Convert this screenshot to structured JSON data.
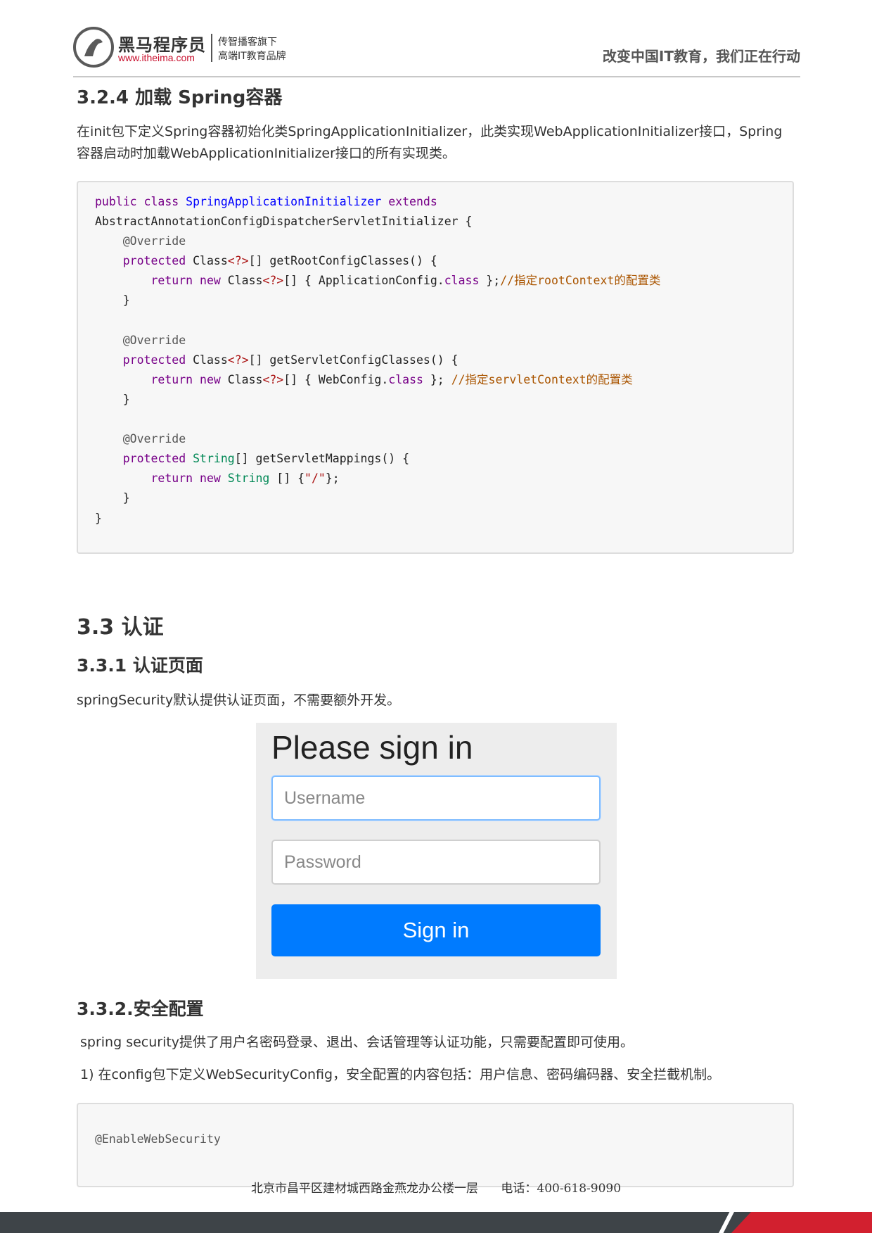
{
  "header": {
    "brand_name": "黑马程序员",
    "brand_url": "www.itheima.com",
    "brand_tag1": "传智播客旗下",
    "brand_tag2": "高端IT教育品牌",
    "slogan": "改变中国IT教育，我们正在行动"
  },
  "section_324": {
    "heading": "3.2.4 加载 Spring容器",
    "desc": "在init包下定义Spring容器初始化类SpringApplicationInitializer，此类实现WebApplicationInitializer接口，Spring容器启动时加载WebApplicationInitializer接口的所有实现类。"
  },
  "section_33": {
    "heading": "3.3 认证"
  },
  "section_331": {
    "heading": "3.3.1 认证页面",
    "desc": "springSecurity默认提供认证页面，不需要额外开发。"
  },
  "login_form": {
    "title": "Please sign in",
    "username_placeholder": "Username",
    "password_placeholder": "Password",
    "submit_label": "Sign in"
  },
  "section_332": {
    "heading": "3.3.2.安全配置",
    "desc": "spring security提供了用户名密码登录、退出、会话管理等认证功能，只需要配置即可使用。",
    "step1": "1) 在config包下定义WebSecurityConfig，安全配置的内容包括：用户信息、密码编码器、安全拦截机制。"
  },
  "code2_line1": "@EnableWebSecurity",
  "footer": {
    "address": "北京市昌平区建材城西路金燕龙办公楼一层",
    "phone": "电话：400-618-9090"
  }
}
